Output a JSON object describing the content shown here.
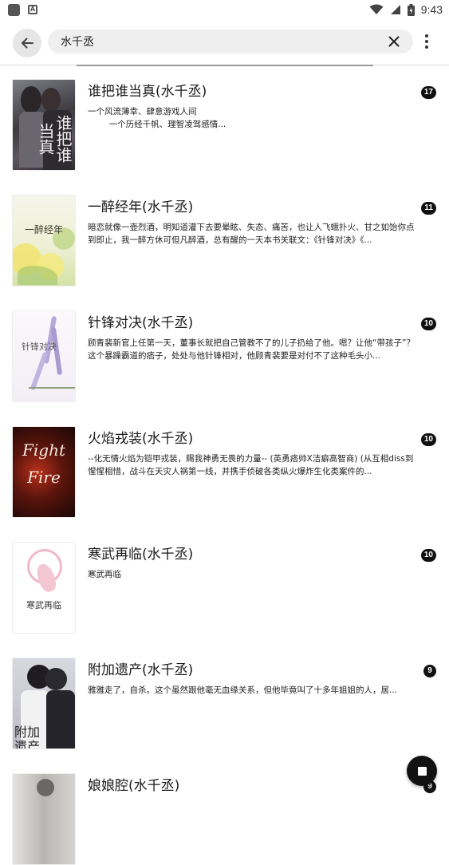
{
  "status_bar": {
    "time": "9:43",
    "left_icons": [
      "square-icon",
      "a-icon"
    ],
    "right_icons": [
      "wifi-icon",
      "signal-icon",
      "battery-icon"
    ]
  },
  "search": {
    "query": "水千丞",
    "placeholder": ""
  },
  "icons": {
    "back": "back-arrow-icon",
    "clear": "close-icon",
    "more": "more-vert-icon",
    "fab": "stop-icon"
  },
  "results": [
    {
      "title": "谁把谁当真(水千丞)",
      "desc": "一个风流薄幸、肆意游戏人间\n        一个历经千帆、理智凌驾感情...",
      "count": "17",
      "cover_text": "谁把谁当真",
      "cover_bg": "#4a4a52"
    },
    {
      "title": "一醉经年(水千丞)",
      "desc": "暗恋就像一壶烈酒，明知道灌下去要晕眩、失态、痛苦，也让人飞蛾扑火、甘之如饴你点到即止，我一醉方休可但凡醉酒，总有醒的一天本书关联文：《针锋对决》《...",
      "count": "11",
      "cover_text": "一醉经年",
      "cover_bg": "#f2f3e4"
    },
    {
      "title": "针锋对决(水千丞)",
      "desc": "顾青裴新官上任第一天，董事长就把自己管教不了的儿子扔给了他。嗯？让他“带孩子”？这个暴躁霸道的痞子，处处与他针锋相对，他顾青裴要是对付不了这种毛头小...",
      "count": "10",
      "cover_text": "针锋对决",
      "cover_bg": "#f7f4f8"
    },
    {
      "title": "火焰戎装(水千丞)",
      "desc": "--化无情火焰为铠甲戎装，赐我神勇无畏的力量-- (英勇痞帅X洁癖高智商) (从互相diss到惺惺相惜，战斗在天灾人祸第一线，并携手侦破各类纵火爆炸生化类案件的...",
      "count": "10",
      "cover_text": "Fight Fire",
      "cover_bg": "#1a0d0a"
    },
    {
      "title": "寒武再临(水千丞)",
      "desc": "寒武再临",
      "count": "10",
      "cover_text": "寒武再临",
      "cover_bg": "#ffffff"
    },
    {
      "title": "附加遗产(水千丞)",
      "desc": "雅雅走了，自杀。这个虽然跟他毫无血缘关系，但他毕竟叫了十多年姐姐的人，居...",
      "count": "9",
      "cover_text": "附加遗产",
      "cover_bg": "#c8c9d0"
    },
    {
      "title": "娘娘腔(水千丞)",
      "desc": "",
      "count": "9",
      "cover_text": "",
      "cover_bg": "#d8d6d2"
    }
  ]
}
